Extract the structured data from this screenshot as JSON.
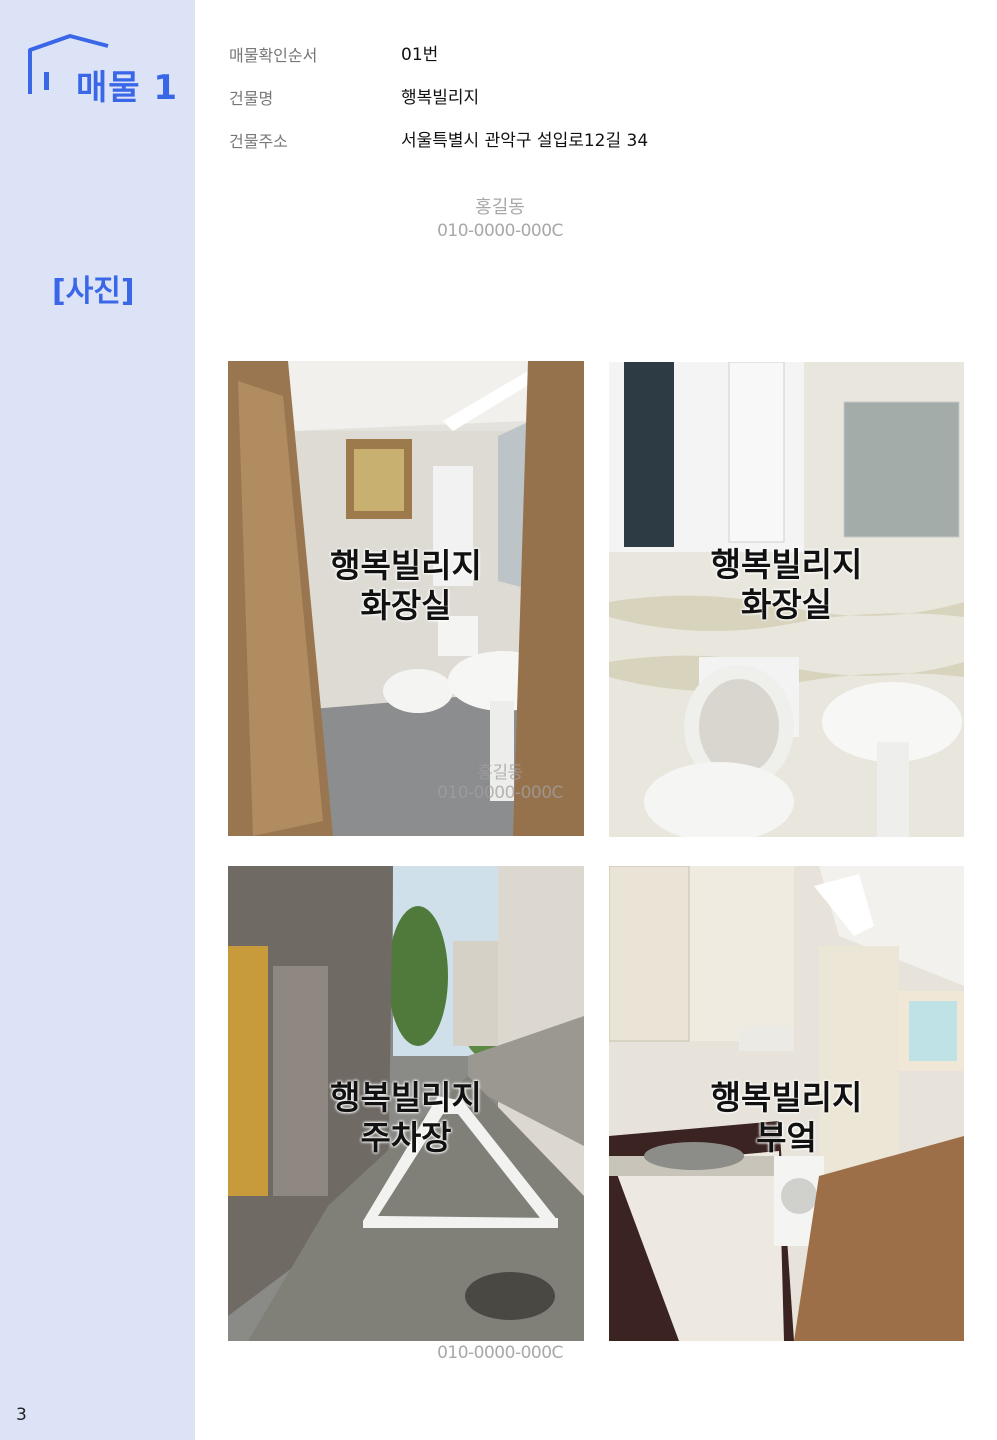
{
  "sidebar": {
    "logo_text": "매물 1",
    "section_label": "[사진]",
    "page_number": "3",
    "accent_color": "#3a67e8",
    "background_color": "#dde3f6"
  },
  "info": {
    "rows": [
      {
        "label": "매물확인순서",
        "value": "01번"
      },
      {
        "label": "건물명",
        "value": "행복빌리지"
      },
      {
        "label": "건물주소",
        "value": "서울특별시 관악구 설입로12길 34"
      }
    ]
  },
  "agent": {
    "name": "홍길동",
    "phone": "010-0000-000C"
  },
  "photos": [
    {
      "line1": "행복빌리지",
      "line2": "화장실"
    },
    {
      "line1": "행복빌리지",
      "line2": "화장실"
    },
    {
      "line1": "행복빌리지",
      "line2": "주차장"
    },
    {
      "line1": "행복빌리지",
      "line2": "부엌"
    }
  ],
  "watermark": {
    "name": "홍길동",
    "phone": "010-0000-000C"
  },
  "bottom_phone": "010-0000-000C"
}
